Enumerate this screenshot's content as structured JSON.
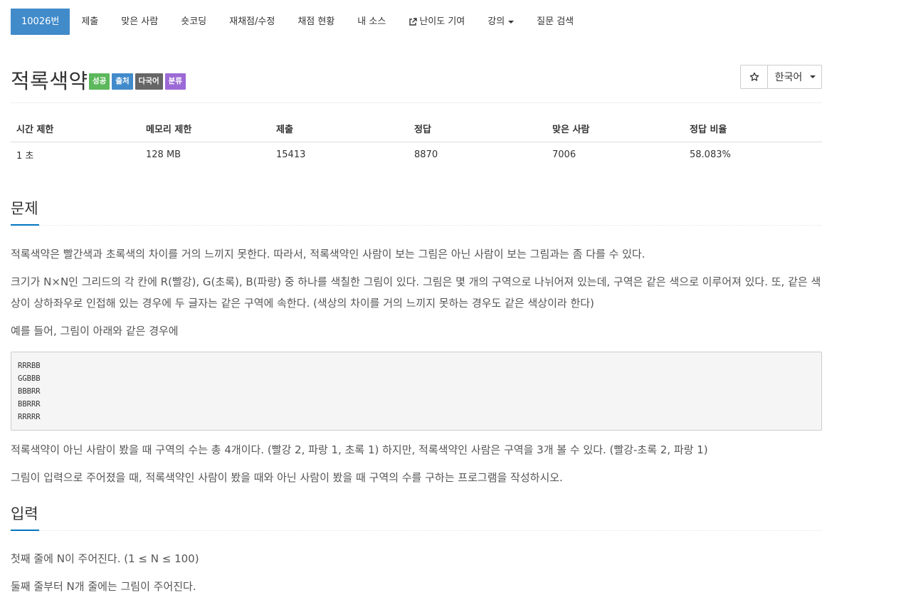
{
  "nav": {
    "items": [
      {
        "label": "10026번",
        "active": true
      },
      {
        "label": "제출"
      },
      {
        "label": "맞은 사람"
      },
      {
        "label": "숏코딩"
      },
      {
        "label": "재채점/수정"
      },
      {
        "label": "채점 현황"
      },
      {
        "label": "내 소스"
      },
      {
        "label": "난이도 기여",
        "icon": "external-link-icon"
      },
      {
        "label": "강의",
        "dropdown": true
      },
      {
        "label": "질문 검색"
      }
    ]
  },
  "problem": {
    "title": "적록색약",
    "labels": [
      {
        "text": "성공",
        "color": "#5cb85c"
      },
      {
        "text": "출처",
        "color": "#428bca"
      },
      {
        "text": "다국어",
        "color": "#666666"
      },
      {
        "text": "분류",
        "color": "#9c6ad6"
      }
    ],
    "star_icon": "star-outline-icon",
    "language": "한국어"
  },
  "stats": {
    "headers": [
      "시간 제한",
      "메모리 제한",
      "제출",
      "정답",
      "맞은 사람",
      "정답 비율"
    ],
    "values": [
      "1 초",
      "128 MB",
      "15413",
      "8870",
      "7006",
      "58.083%"
    ]
  },
  "sections": {
    "problem_title": "문제",
    "problem_paras": [
      "적록색약은 빨간색과 초록색의 차이를 거의 느끼지 못한다. 따라서, 적록색약인 사람이 보는 그림은 아닌 사람이 보는 그림과는 좀 다를 수 있다.",
      "크기가 N×N인 그리드의 각 칸에 R(빨강), G(초록), B(파랑) 중 하나를 색칠한 그림이 있다. 그림은 몇 개의 구역으로 나뉘어져 있는데, 구역은 같은 색으로 이루어져 있다. 또, 같은 색상이 상하좌우로 인접해 있는 경우에 두 글자는 같은 구역에 속한다. (색상의 차이를 거의 느끼지 못하는 경우도 같은 색상이라 한다)",
      "예를 들어, 그림이 아래와 같은 경우에"
    ],
    "sample_grid": "RRRBB\nGGBBB\nBBBRR\nBBRRR\nRRRRR",
    "problem_paras_after": [
      "적록색약이 아닌 사람이 봤을 때 구역의 수는 총 4개이다. (빨강 2, 파랑 1, 초록 1) 하지만, 적록색약인 사람은 구역을 3개 볼 수 있다. (빨강-초록 2, 파랑 1)",
      "그림이 입력으로 주어졌을 때, 적록색약인 사람이 봤을 때와 아닌 사람이 봤을 때 구역의 수를 구하는 프로그램을 작성하시오."
    ],
    "input_title": "입력",
    "input_paras": [
      "첫째 줄에 N이 주어진다. (1 ≤ N ≤ 100)",
      "둘째 줄부터 N개 줄에는 그림이 주어진다."
    ]
  }
}
